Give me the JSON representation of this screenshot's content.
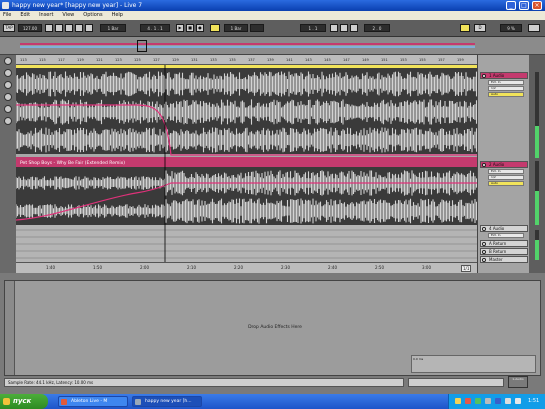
{
  "window": {
    "title": "happy new year* [happy new year] - Live 7",
    "minimize": "_",
    "maximize": "□",
    "close": "×"
  },
  "menu": [
    "File",
    "Edit",
    "Insert",
    "View",
    "Options",
    "Help"
  ],
  "transport": {
    "tap": "TAP",
    "tempo": "127.00",
    "quant": "1 Bar",
    "position": "4 . 1 . 1",
    "bar": "1 Bar",
    "loop_start": "1 . 1",
    "loop_len": "2 . 0",
    "cpu": "9 %",
    "midi": "D"
  },
  "ruler": [
    "113",
    "115",
    "117",
    "119",
    "121",
    "123",
    "125",
    "127",
    "129",
    "131",
    "133",
    "135",
    "137",
    "139",
    "141",
    "143",
    "145",
    "147",
    "149",
    "151",
    "153",
    "155",
    "157",
    "159"
  ],
  "time_axis": [
    "1:40",
    "1:50",
    "2:00",
    "2:10",
    "2:20",
    "2:30",
    "2:40",
    "2:50",
    "3:00"
  ],
  "fraction": "1/1",
  "tracks": {
    "clip_name": "Pet Shop Boys - Why Be Fair (Extended Remix)",
    "track1": "1 Audio",
    "track2": "2 Audio",
    "track3": "4 Audio",
    "return_a": "A Return",
    "return_b": "B Return",
    "master": "Master",
    "in_route": "Ext. In",
    "in_sub": "1/2",
    "io_mode": "In",
    "io_auto": "Auto",
    "io_off": "Off"
  },
  "detail": {
    "drop_label": "Drop Audio Effects Here",
    "cpu_label": "0.0 ms"
  },
  "status": {
    "text": "Sample Rate: 44.1 kHz, Latency: 10.00 ms",
    "right_btn": "1-Audio"
  },
  "taskbar": {
    "start": "пуск",
    "tasks": [
      "Ableton Live - M",
      "happy new year [h..."
    ],
    "clock": "1:51"
  },
  "colors": {
    "clip": "#c43a6e",
    "automation": "#e0317a",
    "waveform": "#eeeeee",
    "track_bg": "#3a3a3a",
    "yellow": "#f1e35a",
    "meter": "#52d26a"
  }
}
